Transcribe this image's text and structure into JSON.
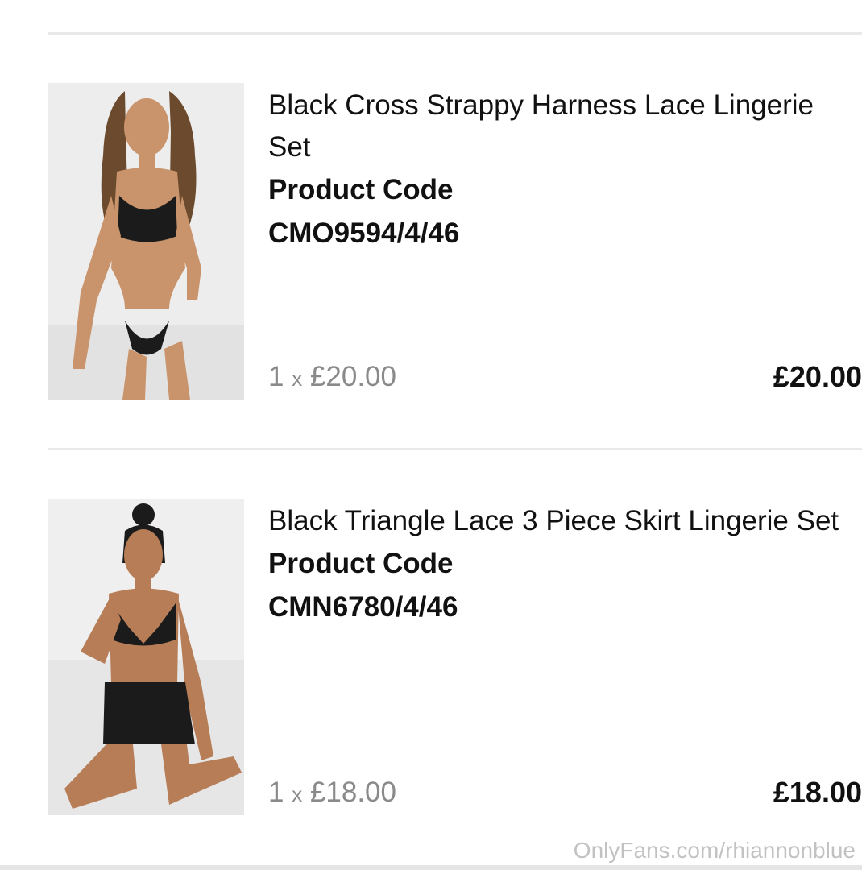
{
  "items": [
    {
      "title": "Black Cross Strappy Harness Lace Lingerie Set",
      "code_label": "Product Code",
      "code": "CMO9594/4/46",
      "qty_count": "1",
      "qty_x": "x",
      "unit_price": "£20.00",
      "total": "£20.00",
      "image_icon": "product-photo-icon"
    },
    {
      "title": "Black Triangle Lace 3 Piece Skirt Lingerie Set",
      "code_label": "Product Code",
      "code": "CMN6780/4/46",
      "qty_count": "1",
      "qty_x": "x",
      "unit_price": "£18.00",
      "total": "£18.00",
      "image_icon": "product-photo-icon"
    }
  ],
  "watermark": "OnlyFans.com/rhiannonblue",
  "colors": {
    "divider": "#e9e9e9",
    "muted_text": "#8a8a8a",
    "text": "#111111",
    "watermark": "#c2c2c2"
  }
}
